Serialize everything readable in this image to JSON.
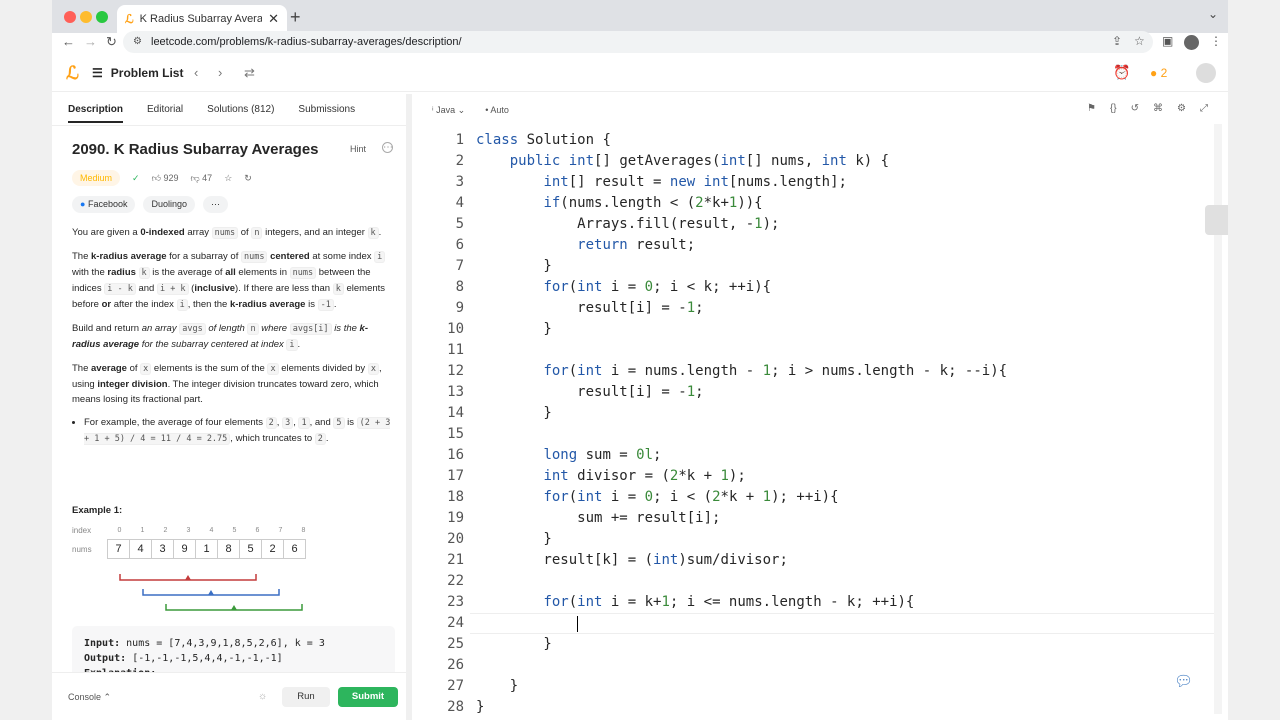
{
  "browser": {
    "tab_title": "K Radius Subarray Averages - L",
    "url": "leetcode.com/problems/k-radius-subarray-averages/description/"
  },
  "header": {
    "problem_list": "Problem List",
    "streak": "2"
  },
  "left": {
    "tabs": [
      "Description",
      "Editorial",
      "Solutions (812)",
      "Submissions"
    ],
    "title": "2090. K Radius Subarray Averages",
    "hint": "Hint",
    "difficulty": "Medium",
    "likes": "929",
    "dislikes": "47",
    "companies": [
      "Facebook",
      "Duolingo"
    ],
    "example_title": "Example 1:",
    "index_label": "index",
    "nums_label": "nums",
    "indices": [
      "0",
      "1",
      "2",
      "3",
      "4",
      "5",
      "6",
      "7",
      "8"
    ],
    "nums": [
      "7",
      "4",
      "3",
      "9",
      "1",
      "8",
      "5",
      "2",
      "6"
    ],
    "input_label": "Input:",
    "input_value": "nums = [7,4,3,9,1,8,5,2,6], k = 3",
    "output_label": "Output:",
    "output_value": "[-1,-1,-1,5,4,4,-1,-1,-1]",
    "explanation_label": "Explanation:",
    "console": "Console",
    "run": "Run",
    "submit": "Submit"
  },
  "editor": {
    "language": "Java",
    "mode": "Auto",
    "line_numbers": [
      "1",
      "2",
      "3",
      "4",
      "5",
      "6",
      "7",
      "8",
      "9",
      "10",
      "11",
      "12",
      "13",
      "14",
      "15",
      "16",
      "17",
      "18",
      "19",
      "20",
      "21",
      "22",
      "23",
      "24",
      "25",
      "26",
      "27",
      "28"
    ]
  }
}
